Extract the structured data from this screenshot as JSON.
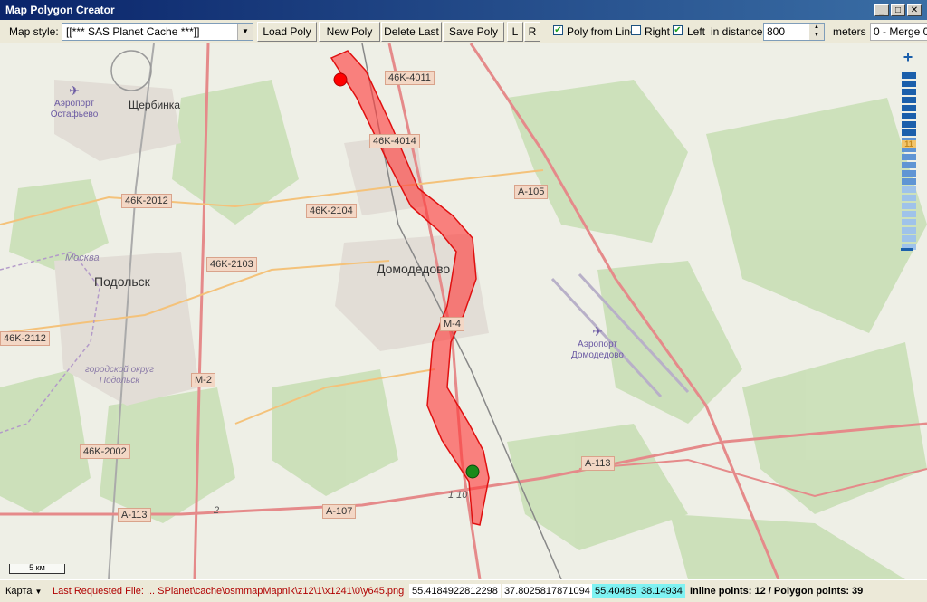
{
  "window": {
    "title": "Map Polygon Creator"
  },
  "toolbar": {
    "map_style_label": "Map style:",
    "map_style_value": "[[*** SAS Planet Cache ***]]",
    "load_poly": "Load Poly",
    "new_poly": "New Poly",
    "delete_last": "Delete Last",
    "save_poly": "Save Poly",
    "l_button": "L",
    "r_button": "R",
    "poly_from_line_label": "Poly from Line",
    "poly_from_line_checked": true,
    "right_label": "Right",
    "right_checked": false,
    "left_label": "Left",
    "left_checked": true,
    "in_distance_label": "in distance",
    "distance_value": "800",
    "meters_label": "meters",
    "merge_label": "0 - Merge 0"
  },
  "map": {
    "road_labels": [
      "46K-4011",
      "46K-4014",
      "A-105",
      "46K-2012",
      "46K-2104",
      "46K-2103",
      "M-4",
      "46K-2112",
      "M-2",
      "46K-2002",
      "A-113",
      "A-113",
      "A-107"
    ],
    "city_labels": [
      "Щербинка",
      "Домодедово",
      "Подольск"
    ],
    "small_labels": [
      "Москва",
      "городской округ Подольск"
    ],
    "airports": [
      {
        "name": "Аэропорт Остафьево"
      },
      {
        "name": "Аэропорт Домодедово"
      }
    ],
    "road_numbers": [
      "2",
      "1 10"
    ],
    "scale_label": "5 км",
    "zoom_level": "11",
    "colors": {
      "polygon": "#ff3b3b",
      "start_marker": "#ff0000",
      "end_marker": "#1a8a1a",
      "zoom": "#1b5fab"
    }
  },
  "status": {
    "map_type": "Карта",
    "last_requested": "Last Requested File: ... SPlanet\\cache\\osmmapMapnik\\z12\\1\\x1241\\0\\y645.png",
    "coord1": "55.4184922812298",
    "coord2": "37.8025817871094",
    "coord3": "55.40485",
    "coord4": "38.14934",
    "points": "Inline points: 12 / Polygon points: 39"
  }
}
